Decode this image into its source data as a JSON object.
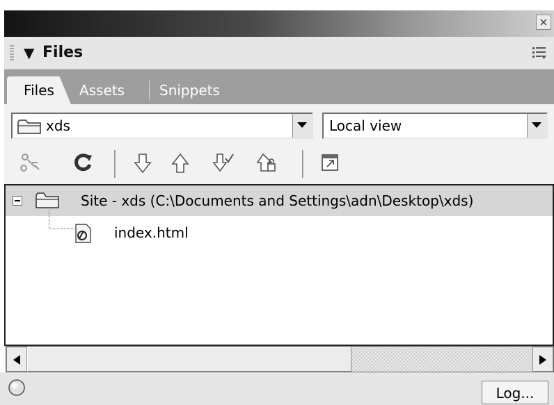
{
  "header": {
    "collapse_glyph": "▼",
    "title": "Files"
  },
  "tabs": [
    {
      "label": "Files",
      "active": true
    },
    {
      "label": "Assets",
      "active": false
    },
    {
      "label": "Snippets",
      "active": false
    }
  ],
  "site_select": {
    "value": "xds",
    "icon": "folder-icon"
  },
  "view_select": {
    "value": "Local view"
  },
  "toolbar": {
    "buttons": [
      {
        "name": "connect-button",
        "icon": "connect-icon"
      },
      {
        "name": "refresh-button",
        "icon": "refresh-icon"
      },
      {
        "name": "get-files-button",
        "icon": "down-arrow-icon"
      },
      {
        "name": "put-files-button",
        "icon": "up-arrow-icon"
      },
      {
        "name": "check-out-button",
        "icon": "check-out-icon"
      },
      {
        "name": "check-in-button",
        "icon": "check-in-icon"
      },
      {
        "name": "expand-button",
        "icon": "expand-icon"
      }
    ]
  },
  "tree": {
    "root": {
      "label": "Site - xds (C:\\Documents and Settings\\adn\\Desktop\\xds)",
      "expanded": true
    },
    "files": [
      {
        "label": "index.html",
        "icon": "html-file-icon"
      }
    ]
  },
  "status": {
    "log_label": "Log..."
  },
  "colors": {
    "tab_strip": "#9e9e9e",
    "selected_row": "#d6d6d6",
    "panel": "#f2f2f2"
  }
}
